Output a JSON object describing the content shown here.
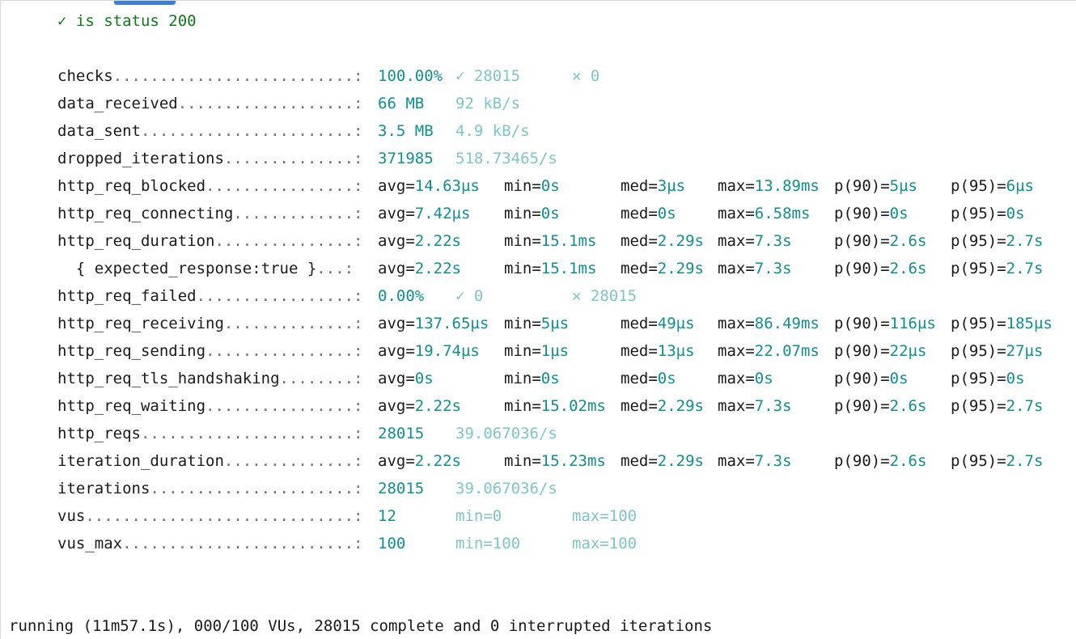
{
  "check": {
    "mark": "✓",
    "label": "is status 200"
  },
  "metrics": [
    {
      "name": "checks",
      "dots": "..........................:",
      "simple": [
        {
          "text": "100.00%",
          "tone": "val"
        },
        {
          "text": "✓ 28015",
          "tone": "light"
        },
        {
          "text": "✕ 0",
          "tone": "light"
        }
      ]
    },
    {
      "name": "data_received",
      "dots": "...................:",
      "simple": [
        {
          "text": "66 MB",
          "tone": "val"
        },
        {
          "text": "92 kB/s",
          "tone": "light"
        }
      ]
    },
    {
      "name": "data_sent",
      "dots": ".......................:",
      "simple": [
        {
          "text": "3.5 MB",
          "tone": "val"
        },
        {
          "text": "4.9 kB/s",
          "tone": "light"
        }
      ]
    },
    {
      "name": "dropped_iterations",
      "dots": "..............:",
      "simple": [
        {
          "text": "371985",
          "tone": "val"
        },
        {
          "text": "518.73465/s",
          "tone": "light"
        }
      ]
    },
    {
      "name": "http_req_blocked",
      "dots": "................:",
      "stats": [
        [
          "avg=",
          "14.63µs"
        ],
        [
          "min=",
          "0s"
        ],
        [
          "med=",
          "3µs"
        ],
        [
          "max=",
          "13.89ms"
        ],
        [
          "p(90)=",
          "5µs"
        ],
        [
          "p(95)=",
          "6µs"
        ]
      ]
    },
    {
      "name": "http_req_connecting",
      "dots": ".............:",
      "stats": [
        [
          "avg=",
          "7.42µs"
        ],
        [
          "min=",
          "0s"
        ],
        [
          "med=",
          "0s"
        ],
        [
          "max=",
          "6.58ms"
        ],
        [
          "p(90)=",
          "0s"
        ],
        [
          "p(95)=",
          "0s"
        ]
      ]
    },
    {
      "name": "http_req_duration",
      "dots": "...............:",
      "stats": [
        [
          "avg=",
          "2.22s"
        ],
        [
          "min=",
          "15.1ms"
        ],
        [
          "med=",
          "2.29s"
        ],
        [
          "max=",
          "7.3s"
        ],
        [
          "p(90)=",
          "2.6s"
        ],
        [
          "p(95)=",
          "2.7s"
        ]
      ]
    },
    {
      "name": "  { expected_response:true }",
      "dots": "...:",
      "stats": [
        [
          "avg=",
          "2.22s"
        ],
        [
          "min=",
          "15.1ms"
        ],
        [
          "med=",
          "2.29s"
        ],
        [
          "max=",
          "7.3s"
        ],
        [
          "p(90)=",
          "2.6s"
        ],
        [
          "p(95)=",
          "2.7s"
        ]
      ]
    },
    {
      "name": "http_req_failed",
      "dots": ".................:",
      "simple": [
        {
          "text": "0.00%",
          "tone": "val"
        },
        {
          "text": "✓ 0",
          "tone": "light"
        },
        {
          "text": "✕ 28015",
          "tone": "light"
        }
      ]
    },
    {
      "name": "http_req_receiving",
      "dots": "..............:",
      "stats": [
        [
          "avg=",
          "137.65µs"
        ],
        [
          "min=",
          "5µs"
        ],
        [
          "med=",
          "49µs"
        ],
        [
          "max=",
          "86.49ms"
        ],
        [
          "p(90)=",
          "116µs"
        ],
        [
          "p(95)=",
          "185µs"
        ]
      ]
    },
    {
      "name": "http_req_sending",
      "dots": "................:",
      "stats": [
        [
          "avg=",
          "19.74µs"
        ],
        [
          "min=",
          "1µs"
        ],
        [
          "med=",
          "13µs"
        ],
        [
          "max=",
          "22.07ms"
        ],
        [
          "p(90)=",
          "22µs"
        ],
        [
          "p(95)=",
          "27µs"
        ]
      ]
    },
    {
      "name": "http_req_tls_handshaking",
      "dots": "........:",
      "stats": [
        [
          "avg=",
          "0s"
        ],
        [
          "min=",
          "0s"
        ],
        [
          "med=",
          "0s"
        ],
        [
          "max=",
          "0s"
        ],
        [
          "p(90)=",
          "0s"
        ],
        [
          "p(95)=",
          "0s"
        ]
      ]
    },
    {
      "name": "http_req_waiting",
      "dots": "................:",
      "stats": [
        [
          "avg=",
          "2.22s"
        ],
        [
          "min=",
          "15.02ms"
        ],
        [
          "med=",
          "2.29s"
        ],
        [
          "max=",
          "7.3s"
        ],
        [
          "p(90)=",
          "2.6s"
        ],
        [
          "p(95)=",
          "2.7s"
        ]
      ]
    },
    {
      "name": "http_reqs",
      "dots": ".......................:",
      "simple": [
        {
          "text": "28015",
          "tone": "val"
        },
        {
          "text": "39.067036/s",
          "tone": "light"
        }
      ]
    },
    {
      "name": "iteration_duration",
      "dots": "..............:",
      "stats": [
        [
          "avg=",
          "2.22s"
        ],
        [
          "min=",
          "15.23ms"
        ],
        [
          "med=",
          "2.29s"
        ],
        [
          "max=",
          "7.3s"
        ],
        [
          "p(90)=",
          "2.6s"
        ],
        [
          "p(95)=",
          "2.7s"
        ]
      ]
    },
    {
      "name": "iterations",
      "dots": "......................:",
      "simple": [
        {
          "text": "28015",
          "tone": "val"
        },
        {
          "text": "39.067036/s",
          "tone": "light"
        }
      ]
    },
    {
      "name": "vus",
      "dots": ".............................:",
      "simple": [
        {
          "text": "12",
          "tone": "val"
        },
        {
          "text": "min=0",
          "tone": "light"
        },
        {
          "text": "max=100",
          "tone": "light"
        }
      ]
    },
    {
      "name": "vus_max",
      "dots": ".........................:",
      "simple": [
        {
          "text": "100",
          "tone": "val"
        },
        {
          "text": "min=100",
          "tone": "light"
        },
        {
          "text": "max=100",
          "tone": "light"
        }
      ]
    }
  ],
  "status_line": "running (11m57.1s), 000/100 VUs, 28015 complete and 0 interrupted iterations"
}
